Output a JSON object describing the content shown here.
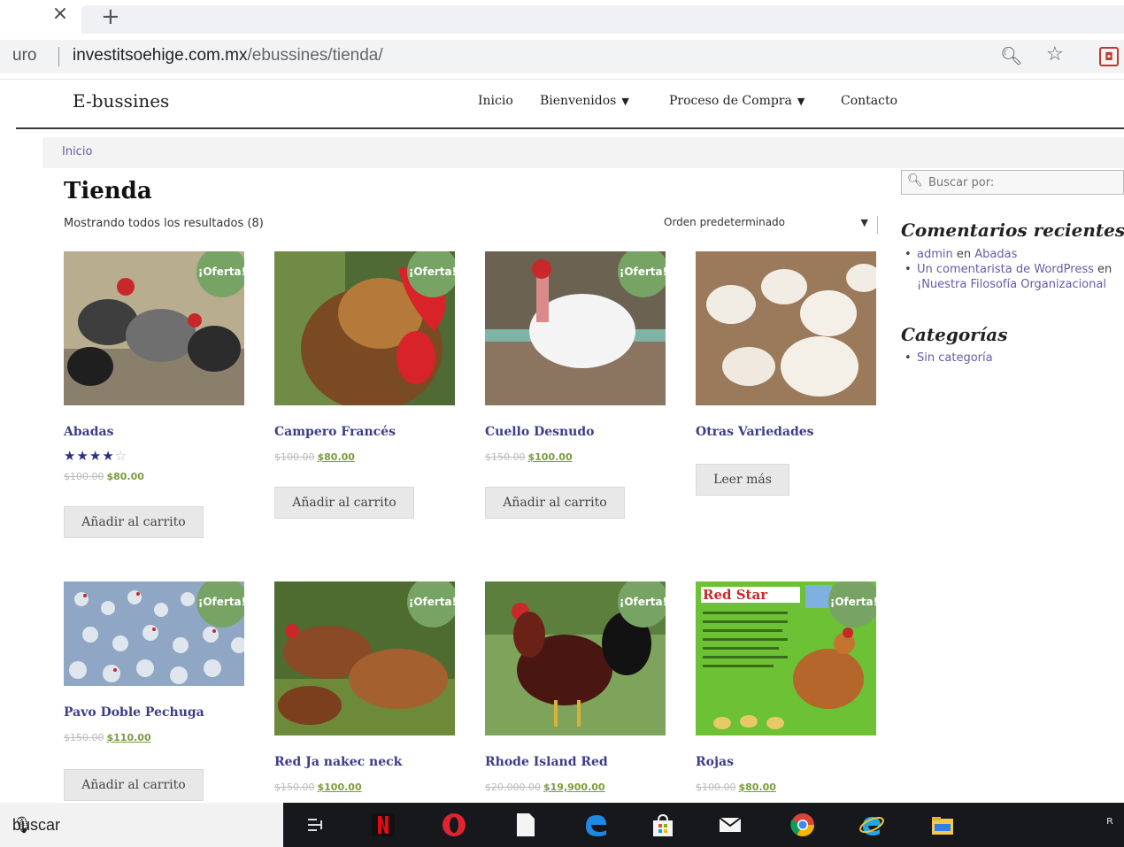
{
  "browser": {
    "tab_close": "×",
    "new_tab": "+",
    "security_text": "uro",
    "url_host": "investitsoehige.com.mx",
    "url_path": "/ebussines/tienda/"
  },
  "site": {
    "title": "E-bussines",
    "nav": [
      {
        "label": "Inicio",
        "dropdown": false
      },
      {
        "label": "Bienvenidos",
        "dropdown": true
      },
      {
        "label": "Proceso de Compra",
        "dropdown": true
      },
      {
        "label": "Contacto",
        "dropdown": false
      }
    ]
  },
  "breadcrumb": "Inicio",
  "shop": {
    "title": "Tienda",
    "result_count": "Mostrando todos los resultados (8)",
    "ordering": "Orden predeterminado",
    "sale_badge": "¡Oferta!",
    "products": [
      {
        "name": "Abadas",
        "old_price": "$100.00",
        "price": "$80.00",
        "rating": 4,
        "button": "Añadir al carrito",
        "sale": true
      },
      {
        "name": "Campero Francés",
        "old_price": "$100.00",
        "price": "$80.00",
        "button": "Añadir al carrito",
        "sale": true
      },
      {
        "name": "Cuello Desnudo",
        "old_price": "$150.00",
        "price": "$100.00",
        "button": "Añadir al carrito",
        "sale": true
      },
      {
        "name": "Otras Variedades",
        "button": "Leer más",
        "sale": false
      },
      {
        "name": "Pavo Doble Pechuga",
        "old_price": "$150.00",
        "price": "$110.00",
        "button": "Añadir al carrito",
        "sale": true
      },
      {
        "name": "Red Ja nakec neck",
        "old_price": "$150.00",
        "price": "$100.00",
        "sale": true
      },
      {
        "name": "Rhode Island Red",
        "old_price": "$20,000.00",
        "price": "$19,900.00",
        "sale": true
      },
      {
        "name": "Rojas",
        "old_price": "$100.00",
        "price": "$80.00",
        "sale": true,
        "image_text": "Red Star"
      }
    ]
  },
  "sidebar": {
    "search_placeholder": "Buscar por:",
    "recent_comments_title": "Comentarios recientes",
    "recent_comments": [
      {
        "author": "admin",
        "connector": "en",
        "post": "Abadas"
      },
      {
        "author": "Un comentarista de WordPress",
        "connector": "en",
        "post": "¡Nuestra Filosofía Organizacional"
      }
    ],
    "categories_title": "Categorías",
    "categories": [
      "Sin categoría"
    ]
  },
  "taskbar": {
    "search_text": "buscar"
  }
}
